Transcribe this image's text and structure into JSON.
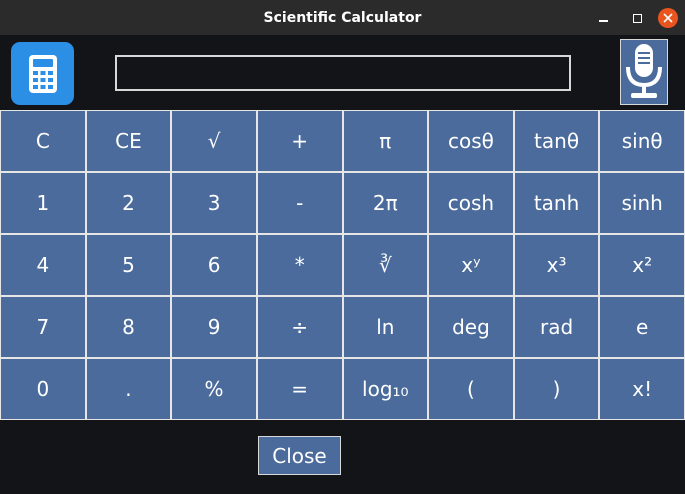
{
  "window": {
    "title": "Scientific Calculator",
    "minimize_icon": "minimize-icon",
    "maximize_icon": "maximize-icon",
    "close_icon": "close-icon"
  },
  "header": {
    "app_icon": "calculator-icon",
    "display_value": "",
    "mic_icon": "microphone-icon"
  },
  "keypad": {
    "rows": [
      [
        "C",
        "CE",
        "√",
        "+",
        "π",
        "cosθ",
        "tanθ",
        "sinθ"
      ],
      [
        "1",
        "2",
        "3",
        "-",
        "2π",
        "cosh",
        "tanh",
        "sinh"
      ],
      [
        "4",
        "5",
        "6",
        "*",
        "∛",
        "xʸ",
        "x³",
        "x²"
      ],
      [
        "7",
        "8",
        "9",
        "÷",
        "ln",
        "deg",
        "rad",
        "e"
      ],
      [
        "0",
        ".",
        "%",
        "=",
        "log₁₀",
        "(",
        ")",
        "x!"
      ]
    ]
  },
  "footer": {
    "close_label": "Close"
  },
  "colors": {
    "background": "#121418",
    "button": "#4a6b9c",
    "grid_border": "#e6e6e6",
    "app_icon": "#2b8fe6",
    "window_close": "#e9541f"
  }
}
